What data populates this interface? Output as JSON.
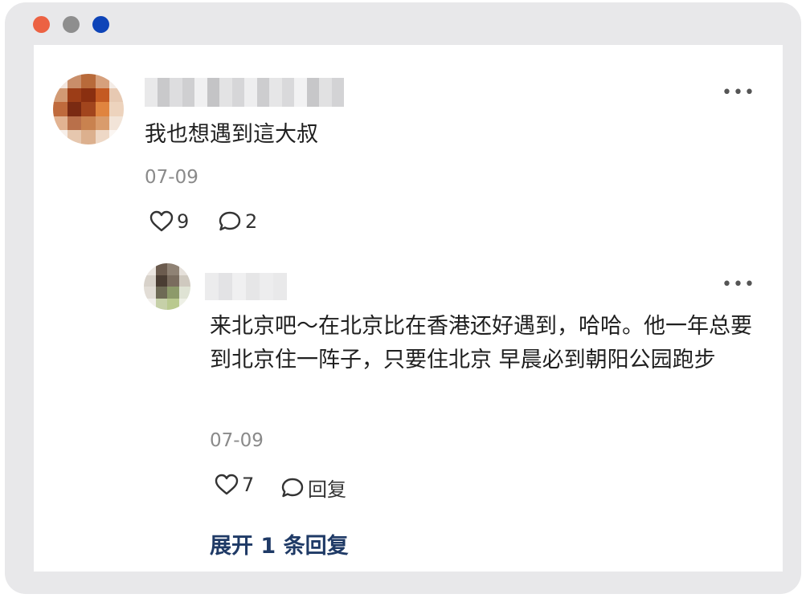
{
  "window_controls": {
    "colors": [
      "#ec6243",
      "#8e8e8e",
      "#0e44b8"
    ]
  },
  "main_comment": {
    "text": "我也想遇到這大叔",
    "date": "07-09",
    "likes": "9",
    "comments": "2",
    "more_icon": "more-icon"
  },
  "reply": {
    "text": "来北京吧～在北京比在香港还好遇到，哈哈。他一年总要到北京住一阵子，只要住北京 早晨必到朝阳公园跑步",
    "date": "07-09",
    "likes": "7",
    "reply_label": "回复",
    "more_icon": "more-icon"
  },
  "expand_label": "展开 1 条回复"
}
